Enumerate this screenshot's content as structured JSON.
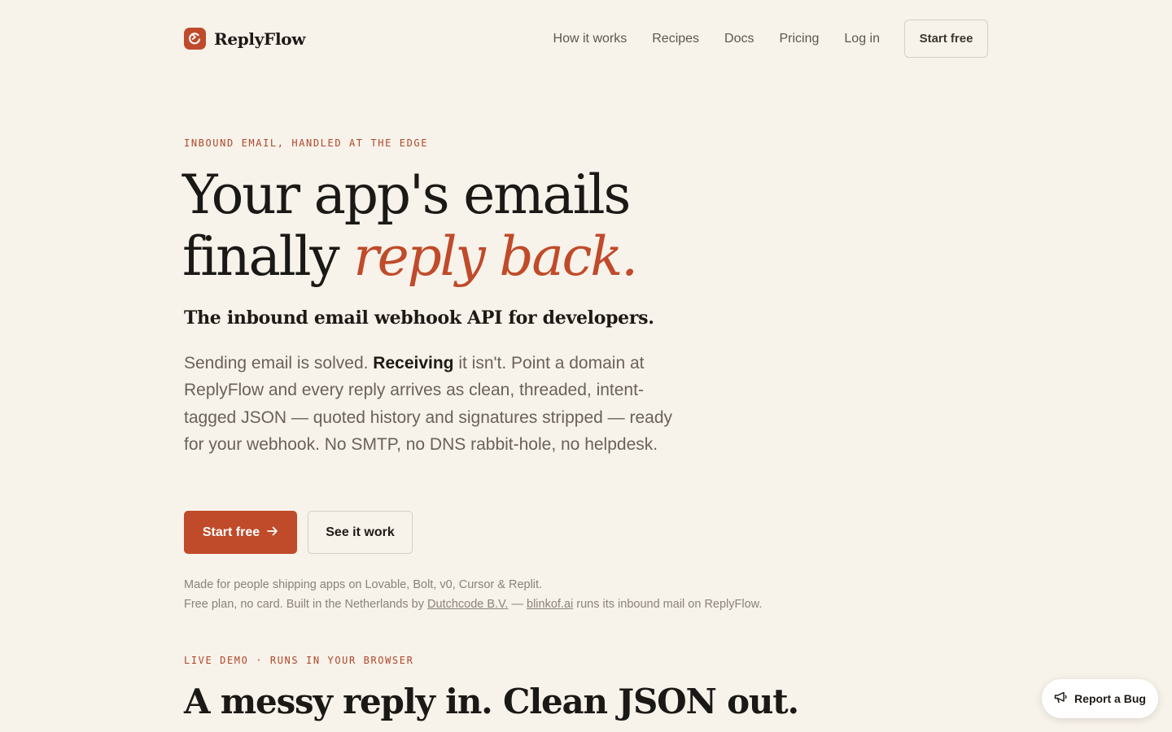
{
  "brand": {
    "name": "ReplyFlow",
    "logo_icon": "reply-arrow-icon",
    "accent_color": "#bf4b2a"
  },
  "nav": {
    "links": [
      "How it works",
      "Recipes",
      "Docs",
      "Pricing",
      "Log in"
    ],
    "cta": "Start free"
  },
  "hero": {
    "eyebrow": "INBOUND EMAIL, HANDLED AT THE EDGE",
    "headline_line1": "Your app's emails",
    "headline_line2_plain": "finally ",
    "headline_line2_accent": "reply back.",
    "subhead": "The inbound email webhook API for developers.",
    "body_before": "Sending email is solved. ",
    "body_bold": "Receiving",
    "body_after": " it isn't. Point a domain at ReplyFlow and every reply arrives as clean, threaded, intent-tagged JSON — quoted history and signatures stripped — ready for your webhook. No SMTP, no DNS rabbit-hole, no helpdesk.",
    "primary_button": "Start free",
    "primary_button_icon": "arrow-right-icon",
    "secondary_button": "See it work",
    "fine_line1": "Made for people shipping apps on Lovable, Bolt, v0, Cursor & Replit.",
    "fine_line2_a": "Free plan, no card. Built in the Netherlands by ",
    "fine_line2_link1": "Dutchcode B.V.",
    "fine_line2_b": " — ",
    "fine_line2_link2": "blinkof.ai",
    "fine_line2_c": " runs its inbound mail on ReplyFlow."
  },
  "demo": {
    "eyebrow": "LIVE DEMO · RUNS IN YOUR BROWSER",
    "title": "A messy reply in. Clean JSON out."
  },
  "floating": {
    "report_bug": "Report a Bug",
    "report_bug_icon": "megaphone-icon"
  }
}
